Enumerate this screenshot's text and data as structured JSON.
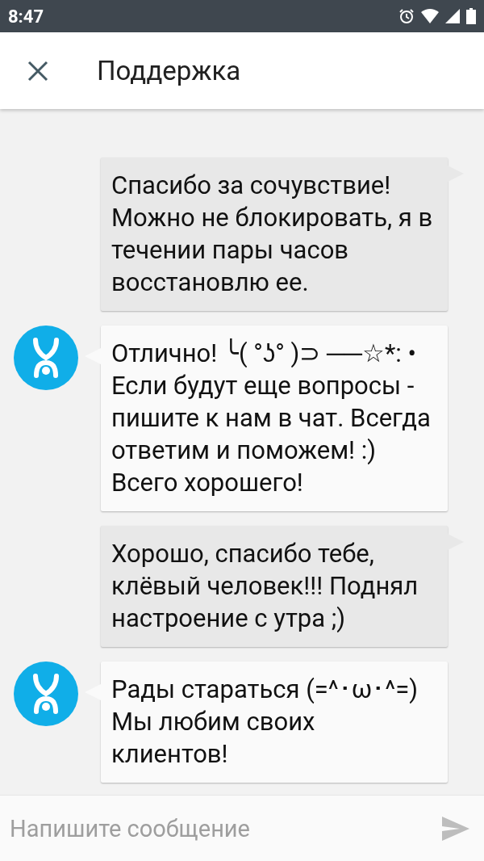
{
  "status_bar": {
    "time": "8:47"
  },
  "header": {
    "title": "Поддержка"
  },
  "messages": [
    {
      "kind": "outgoing",
      "text": "Спасибо за сочувствие! Можно не блокировать, я в течении пары часов восстановлю ее."
    },
    {
      "kind": "incoming",
      "text": "Отлично! ╰( °ʖ° )⊃ ──☆*: • Если будут еще вопросы - пишите к нам в чат. Всегда ответим и поможем! :) Всего хорошего!"
    },
    {
      "kind": "outgoing",
      "text": "Хорошо, спасибо тебе, клёвый человек!!! Поднял настроение с утра ;)"
    },
    {
      "kind": "incoming",
      "text": "Рады стараться (=^･ω･^=) Мы любим своих клиентов!"
    }
  ],
  "composer": {
    "placeholder": "Напишите сообщение"
  }
}
